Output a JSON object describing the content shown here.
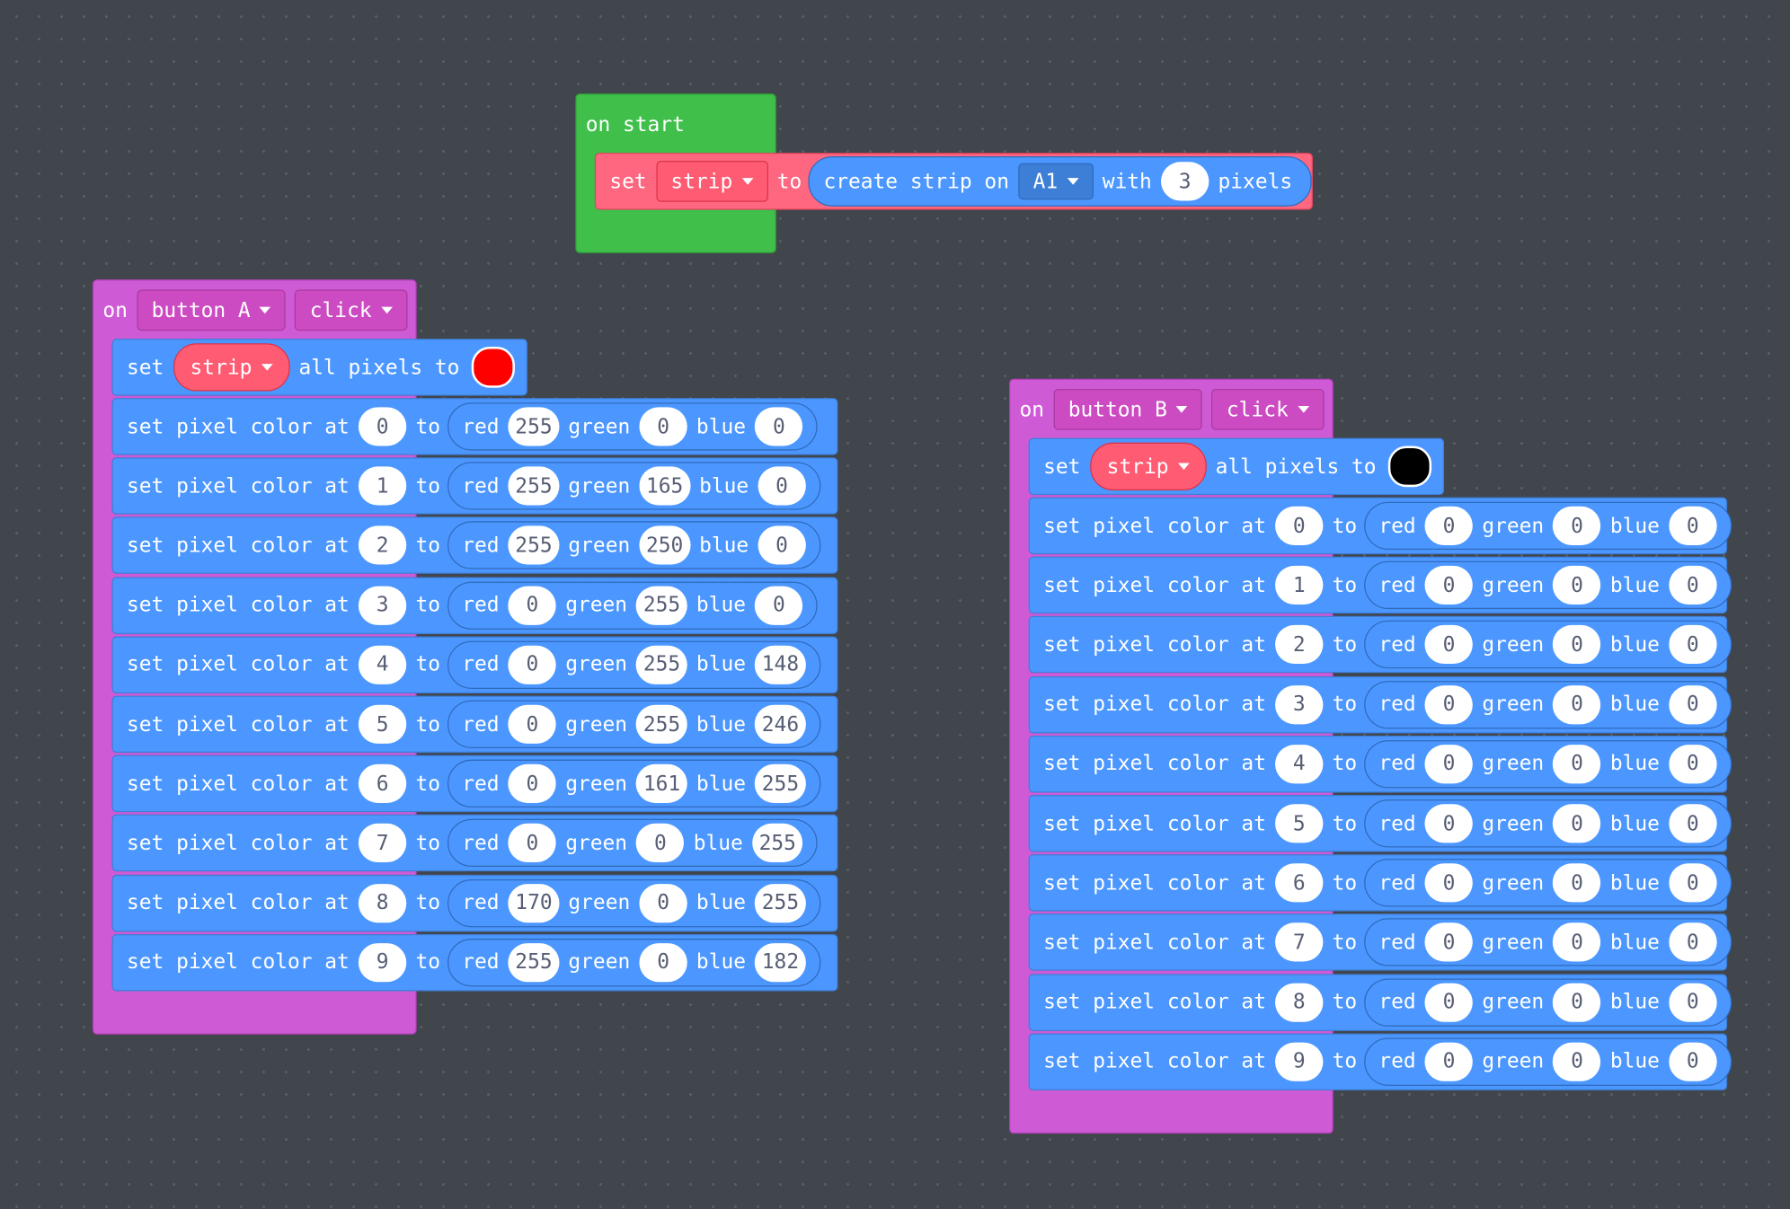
{
  "on_start": {
    "label": "on start",
    "stmt": {
      "set": "set",
      "var": "strip",
      "to": "to",
      "create": "create strip on",
      "pin": "A1",
      "with": "with",
      "count": "3",
      "pixels": "pixels"
    }
  },
  "colors": {
    "event": "#cf5ad6",
    "start": "#40bf4a",
    "looks": "#4c97ff",
    "variable": "#ff6680",
    "background": "#41454c"
  },
  "group_a": {
    "on": "on",
    "button": "button A",
    "action": "click",
    "set_all": {
      "set": "set",
      "var": "strip",
      "text": "all pixels to",
      "swatch": "#ff0000"
    },
    "rows": [
      {
        "idx": "0",
        "r": "255",
        "g": "0",
        "b": "0"
      },
      {
        "idx": "1",
        "r": "255",
        "g": "165",
        "b": "0"
      },
      {
        "idx": "2",
        "r": "255",
        "g": "250",
        "b": "0"
      },
      {
        "idx": "3",
        "r": "0",
        "g": "255",
        "b": "0"
      },
      {
        "idx": "4",
        "r": "0",
        "g": "255",
        "b": "148"
      },
      {
        "idx": "5",
        "r": "0",
        "g": "255",
        "b": "246"
      },
      {
        "idx": "6",
        "r": "0",
        "g": "161",
        "b": "255"
      },
      {
        "idx": "7",
        "r": "0",
        "g": "0",
        "b": "255"
      },
      {
        "idx": "8",
        "r": "170",
        "g": "0",
        "b": "255"
      },
      {
        "idx": "9",
        "r": "255",
        "g": "0",
        "b": "182"
      }
    ]
  },
  "group_b": {
    "on": "on",
    "button": "button B",
    "action": "click",
    "set_all": {
      "set": "set",
      "var": "strip",
      "text": "all pixels to",
      "swatch": "#000000"
    },
    "rows": [
      {
        "idx": "0",
        "r": "0",
        "g": "0",
        "b": "0"
      },
      {
        "idx": "1",
        "r": "0",
        "g": "0",
        "b": "0"
      },
      {
        "idx": "2",
        "r": "0",
        "g": "0",
        "b": "0"
      },
      {
        "idx": "3",
        "r": "0",
        "g": "0",
        "b": "0"
      },
      {
        "idx": "4",
        "r": "0",
        "g": "0",
        "b": "0"
      },
      {
        "idx": "5",
        "r": "0",
        "g": "0",
        "b": "0"
      },
      {
        "idx": "6",
        "r": "0",
        "g": "0",
        "b": "0"
      },
      {
        "idx": "7",
        "r": "0",
        "g": "0",
        "b": "0"
      },
      {
        "idx": "8",
        "r": "0",
        "g": "0",
        "b": "0"
      },
      {
        "idx": "9",
        "r": "0",
        "g": "0",
        "b": "0"
      }
    ]
  },
  "labels": {
    "set_pixel": "set pixel color at",
    "to": "to",
    "red": "red",
    "green": "green",
    "blue": "blue"
  }
}
